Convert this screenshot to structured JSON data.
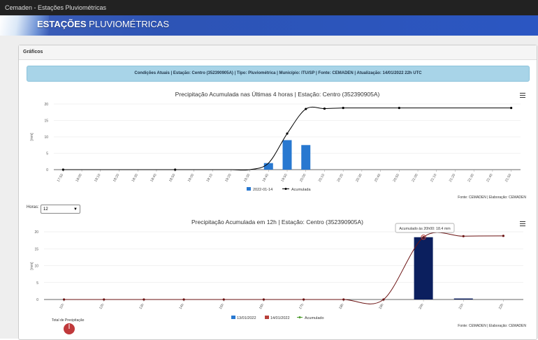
{
  "window": {
    "title": "Cemaden - Estações Pluviométricas"
  },
  "banner": {
    "title_bold": "ESTAÇÕES",
    "title_light": " PLUVIOMÉTRICAS"
  },
  "panel": {
    "title": "Gráficos"
  },
  "info_bar": {
    "text": "Condições Atuais | Estação: Centro (352390905A) | Tipo: Pluviométrica | Município: ITU/SP | Fonte: CEMADEN | Atualização: 14/01/2022 22h UTC"
  },
  "horas": {
    "label": "Horas:",
    "value": "12"
  },
  "colors": {
    "blue_series": "#2878d0",
    "navy_series": "#0b1f5e",
    "red_series": "#b8403a",
    "cumulative_line_chart1": "#000000",
    "cumulative_line_chart2": "#6b1212",
    "green_legend": "#4a9a2a"
  },
  "chart_data": [
    {
      "type": "bar",
      "title": "Precipitação Acumulada nas Últimas 4 horas | Estação: Centro (352390905A)",
      "ylabel": "[mm]",
      "ylim": [
        0,
        20
      ],
      "yticks": [
        "0",
        "5",
        "10",
        "15",
        "20"
      ],
      "categories": [
        "17:50",
        "18:00",
        "18:10",
        "18:20",
        "18:30",
        "18:40",
        "18:50",
        "19:00",
        "19:10",
        "19:20",
        "19:30",
        "19:40",
        "19:50",
        "20:00",
        "20:10",
        "20:20",
        "20:30",
        "20:40",
        "20:50",
        "21:00",
        "21:10",
        "21:20",
        "21:30",
        "21:40",
        "21:50"
      ],
      "series": [
        {
          "name": "2022-01-14",
          "type": "bar",
          "values": [
            0,
            0,
            0,
            0,
            0,
            0,
            0,
            0,
            0,
            0,
            0,
            2,
            9,
            7.5,
            0,
            0,
            0,
            0,
            0,
            0,
            0,
            0,
            0,
            0,
            0
          ]
        },
        {
          "name": "Acumulada",
          "type": "line",
          "values": [
            0,
            0,
            0,
            0,
            0,
            0,
            0,
            0,
            0,
            0,
            0,
            2,
            11,
            18.5,
            18.6,
            18.8,
            18.8,
            18.8,
            18.8,
            18.8,
            18.8,
            18.8,
            18.8,
            18.8,
            18.8
          ],
          "markers_at": [
            0,
            6,
            12,
            13,
            14,
            15,
            18,
            24
          ]
        }
      ],
      "legend_position": "bottom-center",
      "credit": "Fonte: CEMADEN | Elaboração: CEMADEN"
    },
    {
      "type": "bar",
      "title": "Precipitação Acumulada em 12h | Estação: Centro (352390905A)",
      "ylabel": "[mm]",
      "ylim": [
        0,
        20
      ],
      "yticks": [
        "0",
        "5",
        "10",
        "15",
        "20"
      ],
      "categories": [
        "11h",
        "12h",
        "13h",
        "14h",
        "15h",
        "16h",
        "17h",
        "18h",
        "19h",
        "20h",
        "21h",
        "22h"
      ],
      "series": [
        {
          "name": "13/01/2022",
          "type": "bar",
          "values": [
            0,
            0,
            0,
            0,
            0,
            0,
            0,
            0,
            0,
            0,
            0,
            0
          ]
        },
        {
          "name": "14/01/2022",
          "type": "bar",
          "values": [
            0,
            0,
            0,
            0,
            0,
            0,
            0,
            0,
            0,
            18.4,
            0.3,
            0
          ]
        },
        {
          "name": "Acumulado",
          "type": "line",
          "values": [
            0,
            0,
            0,
            0,
            0,
            0,
            0,
            0,
            0,
            18.4,
            18.7,
            18.8
          ]
        }
      ],
      "tooltip": "Acumulado às 20h00: 18.4 mm",
      "legend_position": "bottom-center",
      "credit": "Fonte: CEMADEN | Elaboração: CEMADEN"
    }
  ],
  "footer": {
    "total_label": "Total de Precipitação"
  }
}
